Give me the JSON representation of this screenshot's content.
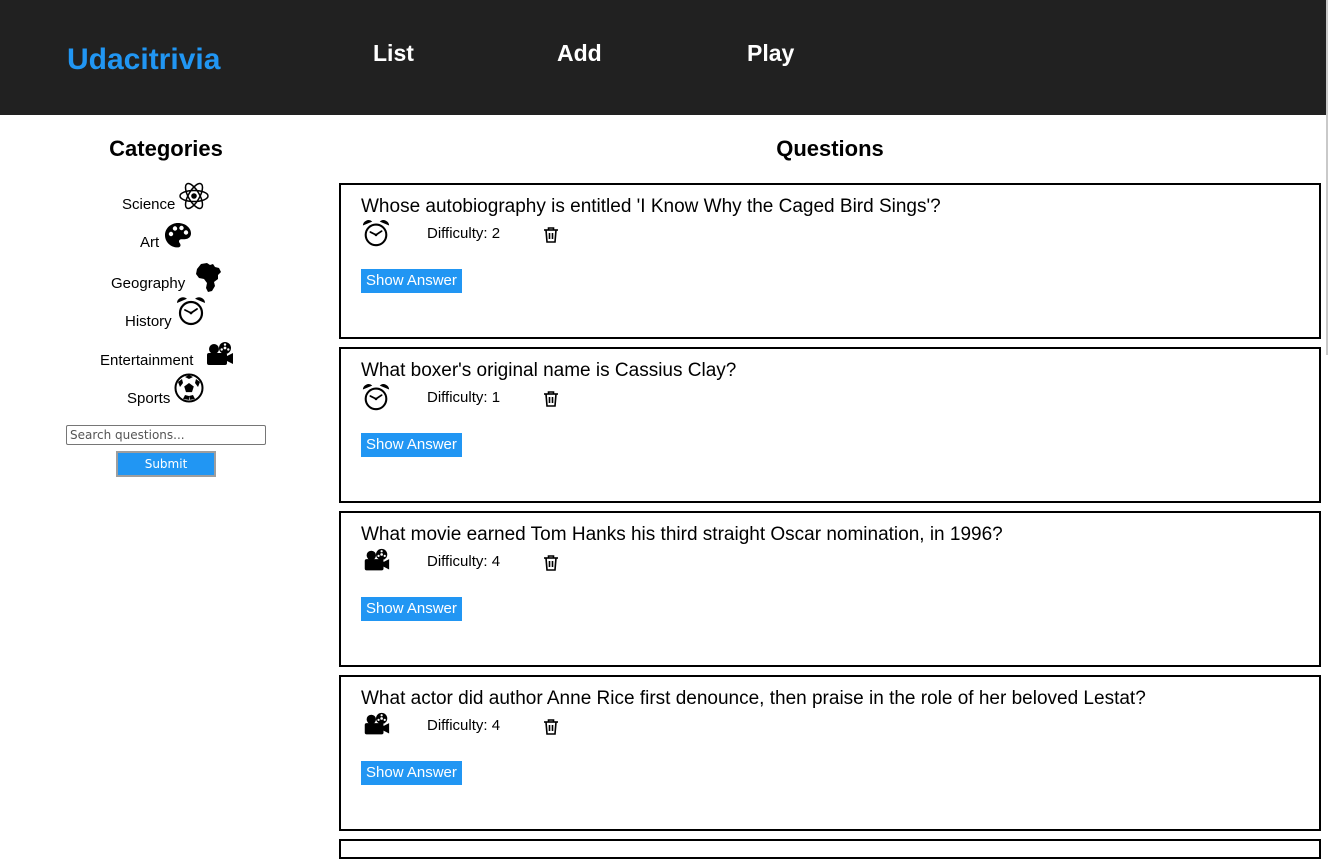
{
  "header": {
    "brand": "Udacitrivia",
    "nav": [
      {
        "label": "List"
      },
      {
        "label": "Add"
      },
      {
        "label": "Play"
      }
    ]
  },
  "sidebar": {
    "title": "Categories",
    "categories": [
      {
        "label": "Science",
        "icon": "atom-icon"
      },
      {
        "label": "Art",
        "icon": "palette-icon"
      },
      {
        "label": "Geography",
        "icon": "africa-icon"
      },
      {
        "label": "History",
        "icon": "alarm-clock-icon"
      },
      {
        "label": "Entertainment",
        "icon": "film-projector-icon"
      },
      {
        "label": "Sports",
        "icon": "soccer-ball-icon"
      }
    ],
    "search": {
      "placeholder": "Search questions...",
      "value": ""
    },
    "submit_label": "Submit"
  },
  "main": {
    "title": "Questions",
    "questions": [
      {
        "text": "Whose autobiography is entitled 'I Know Why the Caged Bird Sings'?",
        "category_icon": "alarm-clock-icon",
        "difficulty": "Difficulty: 2",
        "show_answer": "Show Answer"
      },
      {
        "text": "What boxer's original name is Cassius Clay?",
        "category_icon": "alarm-clock-icon",
        "difficulty": "Difficulty: 1",
        "show_answer": "Show Answer"
      },
      {
        "text": "What movie earned Tom Hanks his third straight Oscar nomination, in 1996?",
        "category_icon": "film-projector-icon",
        "difficulty": "Difficulty: 4",
        "show_answer": "Show Answer"
      },
      {
        "text": "What actor did author Anne Rice first denounce, then praise in the role of her beloved Lestat?",
        "category_icon": "film-projector-icon",
        "difficulty": "Difficulty: 4",
        "show_answer": "Show Answer"
      }
    ]
  },
  "colors": {
    "header_bg": "#212121",
    "accent": "#2196f3",
    "text": "#000000"
  }
}
